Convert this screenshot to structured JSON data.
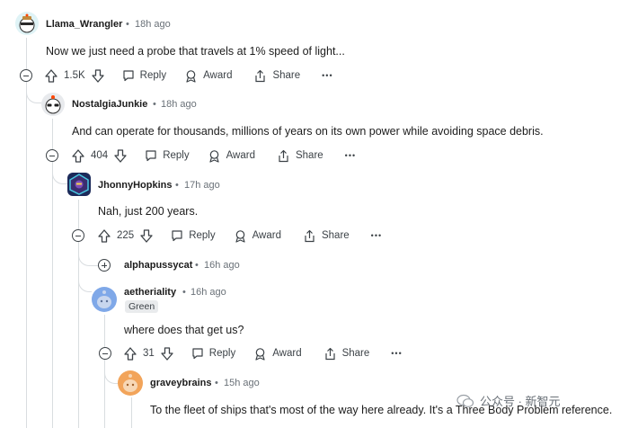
{
  "comments": [
    {
      "username": "Llama_Wrangler",
      "time": "18h ago",
      "text": "Now we just need a probe that travels at 1% speed of light...",
      "votes": "1.5K"
    },
    {
      "username": "NostalgiaJunkie",
      "time": "18h ago",
      "text": "And can operate for thousands, millions of years on its own power while avoiding space debris.",
      "votes": "404"
    },
    {
      "username": "JhonnyHopkins",
      "time": "17h ago",
      "text": "Nah, just 200 years.",
      "votes": "225"
    },
    {
      "username": "alphapussycat",
      "time": "16h ago"
    },
    {
      "username": "aetheriality",
      "time": "16h ago",
      "flair": "Green",
      "text": "where does that get us?",
      "votes": "31"
    },
    {
      "username": "graveybrains",
      "time": "15h ago",
      "text": "To the fleet of ships that's most of the way here already. It's a Three Body Problem reference."
    }
  ],
  "actions": {
    "reply": "Reply",
    "award": "Award",
    "share": "Share",
    "more": "•••"
  },
  "separator": "•",
  "watermark": "公众号 · 新智元",
  "icons": {
    "upvote": "arrow-up-icon",
    "downvote": "arrow-down-icon",
    "reply": "speech-bubble-icon",
    "award": "award-icon",
    "share": "share-icon",
    "collapse": "minus-circle-icon",
    "expand": "plus-circle-icon"
  }
}
